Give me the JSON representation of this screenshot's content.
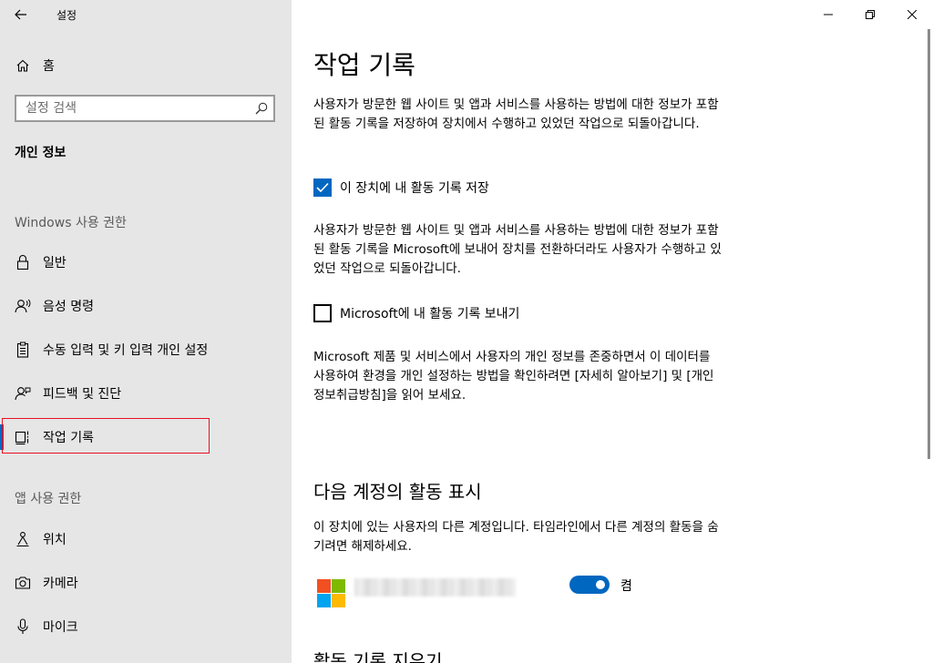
{
  "window": {
    "title": "설정"
  },
  "sidebar": {
    "home_label": "홈",
    "search_placeholder": "설정 검색",
    "section_title": "개인 정보",
    "groups": [
      {
        "header": "Windows 사용 권한",
        "items": [
          {
            "label": "일반",
            "icon": "lock-icon"
          },
          {
            "label": "음성 명령",
            "icon": "speech-icon"
          },
          {
            "label": "수동 입력 및 키 입력 개인 설정",
            "icon": "clipboard-icon"
          },
          {
            "label": "피드백 및 진단",
            "icon": "feedback-icon"
          },
          {
            "label": "작업 기록",
            "icon": "activity-history-icon",
            "selected": true
          }
        ]
      },
      {
        "header": "앱 사용 권한",
        "items": [
          {
            "label": "위치",
            "icon": "location-icon"
          },
          {
            "label": "카메라",
            "icon": "camera-icon"
          },
          {
            "label": "마이크",
            "icon": "microphone-icon"
          }
        ]
      }
    ]
  },
  "main": {
    "title": "작업 기록",
    "para1": "사용자가 방문한 웹 사이트 및 앱과 서비스를 사용하는 방법에 대한 정보가 포함된 활동 기록을 저장하여 장치에서 수행하고 있었던 작업으로 되돌아갑니다.",
    "checkbox1": {
      "label": "이 장치에 내 활동 기록 저장",
      "checked": true
    },
    "para2": "사용자가 방문한 웹 사이트 및 앱과 서비스를 사용하는 방법에 대한 정보가 포함된 활동 기록을 Microsoft에 보내어 장치를 전환하더라도 사용자가 수행하고 있었던 작업으로 되돌아갑니다.",
    "checkbox2": {
      "label": "Microsoft에 내 활동 기록 보내기",
      "checked": false
    },
    "para3": "Microsoft 제품 및 서비스에서 사용자의 개인 정보를 존중하면서 이 데이터를 사용하여 환경을 개인 설정하는 방법을 확인하려면 [자세히 알아보기] 및 [개인정보취급방침]을 읽어 보세요.",
    "accounts_heading": "다음 계정의 활동 표시",
    "accounts_desc": "이 장치에 있는 사용자의 다른 계정입니다. 타임라인에서 다른 계정의 활동을 숨기려면 해제하세요.",
    "account": {
      "toggle_on": true,
      "toggle_label": "켬"
    },
    "clear_heading": "활동 기록 지우기"
  },
  "colors": {
    "accent": "#0067c0",
    "sidebar_bg": "#e6e6e6",
    "highlight": "#e81123",
    "ms_red": "#f25022",
    "ms_green": "#7fba00",
    "ms_blue": "#00a4ef",
    "ms_yellow": "#ffb900"
  }
}
